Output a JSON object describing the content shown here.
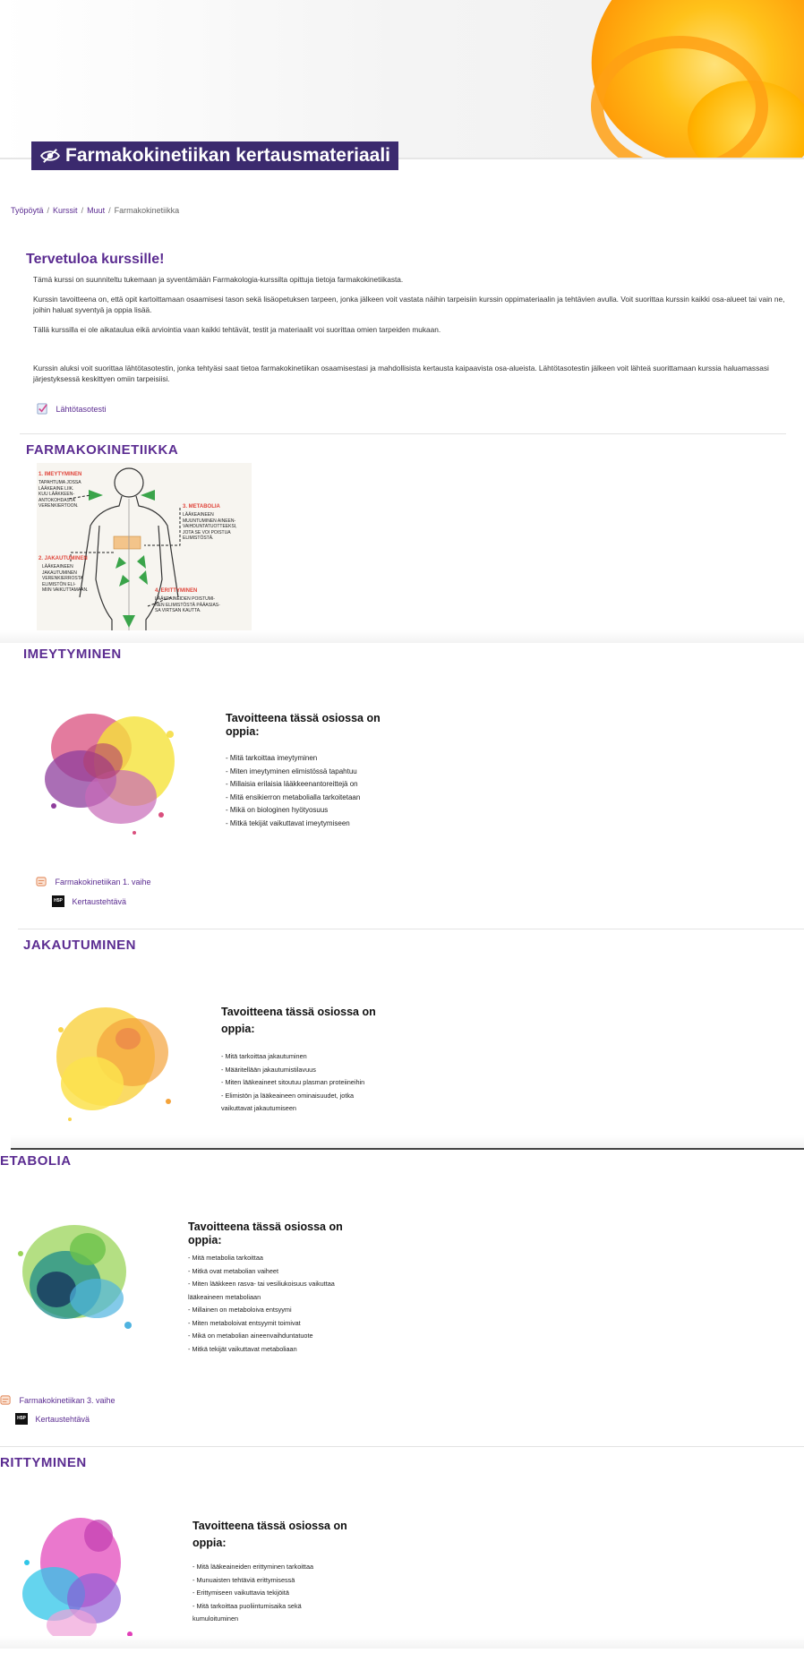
{
  "header": {
    "course_title": "Farmakokinetiikan kertausmateriaali",
    "icon": "eye-slash-icon"
  },
  "breadcrumb": {
    "items": [
      "Työpöytä",
      "Kurssit",
      "Muut"
    ],
    "current": "Farmakokinetiikka",
    "separator": "/"
  },
  "welcome": {
    "title": "Tervetuloa kurssille!",
    "p1": "Tämä kurssi on suunniteltu tukemaan ja syventämään Farmakologia-kurssilta opittuja tietoja farmakokinetiikasta.",
    "p2": "Kurssin tavoitteena on, että opit kartoittamaan osaamisesi tason sekä lisäopetuksen tarpeen, jonka jälkeen voit vastata näihin tarpeisiin kurssin oppimateriaalin ja tehtävien avulla. Voit suorittaa kurssin kaikki osa-alueet tai vain ne, joihin haluat syventyä ja oppia lisää.",
    "p3": "Tällä kurssilla ei ole aikataulua eikä arviointia vaan kaikki tehtävät, testit ja materiaalit voi suorittaa omien tarpeiden mukaan.",
    "p4": "Kurssin aluksi voit suorittaa lähtötasotestin, jonka tehtyäsi saat tietoa farmakokinetiikan osaamisestasi ja mahdollisista kertausta kaipaavista osa-alueista. Lähtötasotestin jälkeen voit lähteä suorittamaan kurssia haluamassasi järjestyksessä keskittyen omiin tarpeisiisi.",
    "quiz_link": "Lähtötasotesti"
  },
  "farmakokinetiikka": {
    "title": "FARMAKOKINETIIKKA",
    "diagram": {
      "l1": "1. IMEYTYMINEN",
      "l1_text": [
        "TAPAHTUMA JOSSA",
        "LÄÄKEAINE LIIK.",
        "KUU LÄÄKKEEN-",
        "ANTOKOHDASTA",
        "VERENKIERTOON."
      ],
      "l2": "2. JAKAUTUMINEN",
      "l2_text": [
        "LÄÄKEAINEEN",
        "JAKAUTUMINEN",
        "VERENKIERROSTA",
        "ELIMISTÖN ELI-",
        "MIIN VAIKUTTAMAAN."
      ],
      "l3": "3. METABOLIA",
      "l3_text": [
        "LÄÄKEAINEEN",
        "MUUNTUMINEN AINEEN-",
        "VAIHDUNTATUOTTEEKSI,",
        "JOTA SE VOI POISTUA",
        "ELIMISTÖSTÄ."
      ],
      "l4": "4. ERITTYMINEN",
      "l4_text": [
        "LÄÄKEAINEIDEN POISTUMI-",
        "NEN ELIMISTÖSTÄ PÄÄASIAS-",
        "SA VIRTSAN KAUTTA."
      ]
    }
  },
  "imeytyminen": {
    "title": "IMEYTYMINEN",
    "obj_title": [
      "Tavoitteena tässä osiossa on",
      "oppia:"
    ],
    "items": [
      "- Mitä tarkoittaa imeytyminen",
      "- Miten imeytyminen elimistössä tapahtuu",
      "- Millaisia erilaisia lääkkeenantoreittejä on",
      "- Mitä ensikierron metabolialla tarkoitetaan",
      "- Mikä on biologinen hyötyosuus",
      "- Mitkä tekijät vaikuttavat imeytymiseen"
    ],
    "link1": "Farmakokinetiikan 1. vaihe",
    "link2": "Kertaustehtävä"
  },
  "jakautuminen": {
    "title": "JAKAUTUMINEN",
    "obj_title": [
      "Tavoitteena tässä osiossa on",
      "oppia:"
    ],
    "items": [
      "- Mitä tarkoittaa jakautuminen",
      "- Määritellään jakautumistilavuus",
      "- Miten lääkeaineet sitoutuu plasman proteiineihin",
      "- Elimistön ja lääkeaineen ominaisuudet, jotka",
      "vaikuttavat jakautumiseen"
    ]
  },
  "metabolia": {
    "title": "ETABOLIA",
    "obj_title": [
      "Tavoitteena tässä osiossa on",
      "oppia:"
    ],
    "items": [
      "- Mitä metabolia tarkoittaa",
      "- Mitkä ovat metabolian vaiheet",
      "- Miten lääkkeen rasva- tai vesiliukoisuus vaikuttaa",
      "lääkeaineen metaboliaan",
      "- Millainen on metaboloiva entsyymi",
      "- Miten metaboloivat entsyymit toimivat",
      "- Mikä on metabolian aineenvaihduntatuote",
      "- Mitkä tekijät vaikuttavat metaboliaan"
    ],
    "link1": "Farmakokinetiikan 3. vaihe",
    "link2": "Kertaustehtävä"
  },
  "erittyminen": {
    "title": "RITTYMINEN",
    "obj_title": [
      "Tavoitteena tässä osiossa on",
      "oppia:"
    ],
    "items": [
      "- Mitä lääkeaineiden erittyminen tarkoittaa",
      "- Munuaisten tehtäviä erittymisessä",
      "- Erittymiseen vaikuttavia tekijöitä",
      "- Mitä tarkoittaa puoliintumisaika sekä",
      "kumuloituminen"
    ]
  },
  "h5p_badge": "H5P",
  "colors": {
    "accent": "#5b2c91",
    "title_bg": "#3b2a6e"
  }
}
